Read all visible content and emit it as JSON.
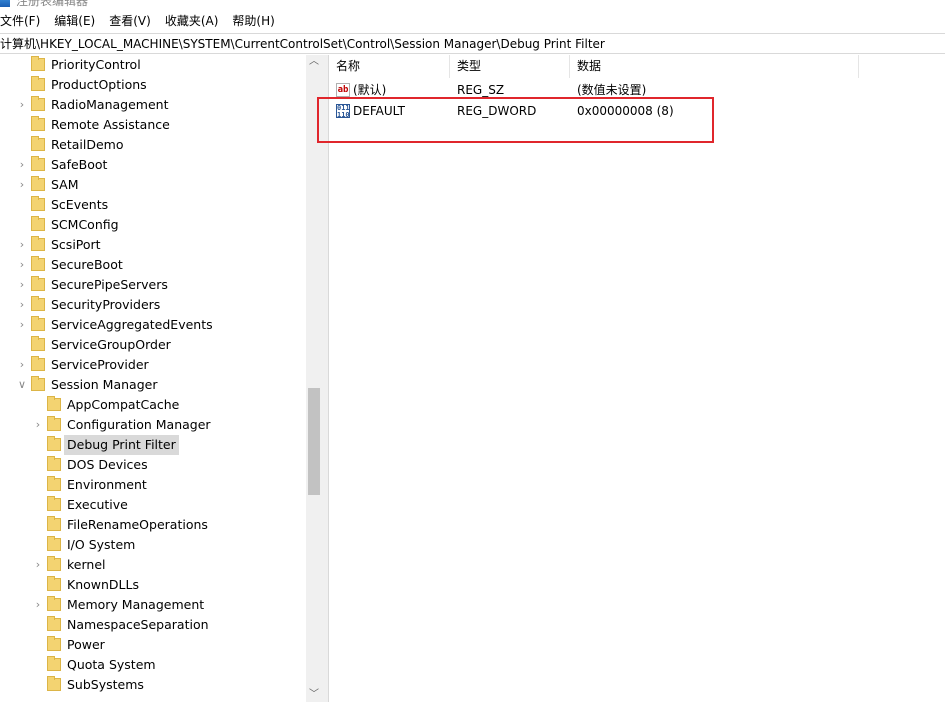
{
  "window": {
    "title": "注册表编辑器"
  },
  "menu": [
    "文件(F)",
    "编辑(E)",
    "查看(V)",
    "收藏夹(A)",
    "帮助(H)"
  ],
  "address": "计算机\\HKEY_LOCAL_MACHINE\\SYSTEM\\CurrentControlSet\\Control\\Session Manager\\Debug Print Filter",
  "tree": [
    {
      "label": "PriorityControl",
      "expandable": false,
      "level": 1
    },
    {
      "label": "ProductOptions",
      "expandable": false,
      "level": 1
    },
    {
      "label": "RadioManagement",
      "expandable": true,
      "level": 1
    },
    {
      "label": "Remote Assistance",
      "expandable": false,
      "level": 1
    },
    {
      "label": "RetailDemo",
      "expandable": false,
      "level": 1
    },
    {
      "label": "SafeBoot",
      "expandable": true,
      "level": 1
    },
    {
      "label": "SAM",
      "expandable": true,
      "level": 1
    },
    {
      "label": "ScEvents",
      "expandable": false,
      "level": 1
    },
    {
      "label": "SCMConfig",
      "expandable": false,
      "level": 1
    },
    {
      "label": "ScsiPort",
      "expandable": true,
      "level": 1
    },
    {
      "label": "SecureBoot",
      "expandable": true,
      "level": 1
    },
    {
      "label": "SecurePipeServers",
      "expandable": true,
      "level": 1
    },
    {
      "label": "SecurityProviders",
      "expandable": true,
      "level": 1
    },
    {
      "label": "ServiceAggregatedEvents",
      "expandable": true,
      "level": 1
    },
    {
      "label": "ServiceGroupOrder",
      "expandable": false,
      "level": 1
    },
    {
      "label": "ServiceProvider",
      "expandable": true,
      "level": 1
    },
    {
      "label": "Session Manager",
      "expandable": true,
      "expanded": true,
      "level": 1
    },
    {
      "label": "AppCompatCache",
      "expandable": false,
      "level": 2
    },
    {
      "label": "Configuration Manager",
      "expandable": true,
      "level": 2
    },
    {
      "label": "Debug Print Filter",
      "expandable": false,
      "level": 2,
      "selected": true
    },
    {
      "label": "DOS Devices",
      "expandable": false,
      "level": 2
    },
    {
      "label": "Environment",
      "expandable": false,
      "level": 2
    },
    {
      "label": "Executive",
      "expandable": false,
      "level": 2
    },
    {
      "label": "FileRenameOperations",
      "expandable": false,
      "level": 2
    },
    {
      "label": "I/O System",
      "expandable": false,
      "level": 2
    },
    {
      "label": "kernel",
      "expandable": true,
      "level": 2
    },
    {
      "label": "KnownDLLs",
      "expandable": false,
      "level": 2
    },
    {
      "label": "Memory Management",
      "expandable": true,
      "level": 2
    },
    {
      "label": "NamespaceSeparation",
      "expandable": false,
      "level": 2
    },
    {
      "label": "Power",
      "expandable": false,
      "level": 2
    },
    {
      "label": "Quota System",
      "expandable": false,
      "level": 2
    },
    {
      "label": "SubSystems",
      "expandable": false,
      "level": 2
    }
  ],
  "list": {
    "columns": [
      "名称",
      "类型",
      "数据"
    ],
    "rows": [
      {
        "icon": "string-value-icon",
        "name": "(默认)",
        "type": "REG_SZ",
        "data": "(数值未设置)"
      },
      {
        "icon": "binary-value-icon",
        "name": "DEFAULT",
        "type": "REG_DWORD",
        "data": "0x00000008 (8)"
      }
    ]
  },
  "colors": {
    "highlight": "#e0262c",
    "selection": "#d9d9d9",
    "folder": "#f3d371"
  }
}
